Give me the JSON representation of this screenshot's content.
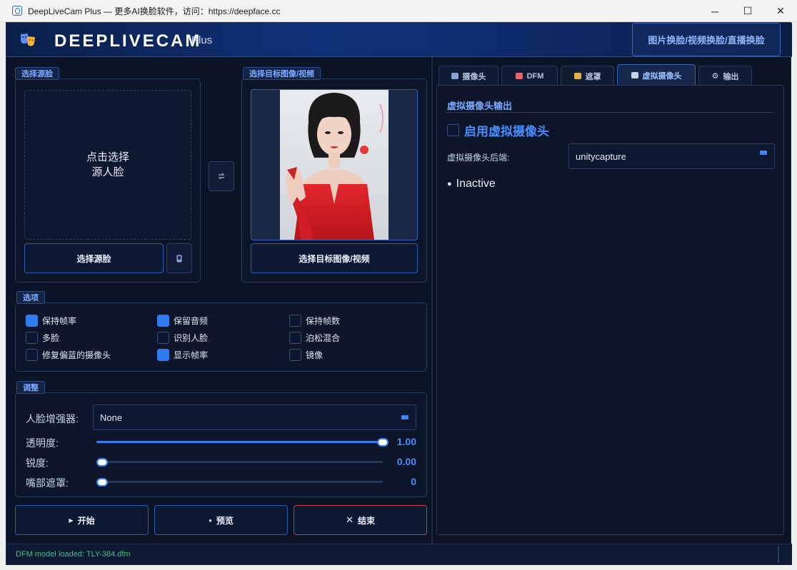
{
  "window": {
    "title": "DeepLiveCam Plus — 更多AI换脸软件，访问：https://deepface.cc",
    "minimize_glyph": "─",
    "maximize_glyph": "☐",
    "close_glyph": "✕"
  },
  "header": {
    "brand": "DEEPLIVECAM",
    "brand_suffix": "Plus",
    "mode_button": "图片换脸/视频换脸/直播换脸"
  },
  "source": {
    "group_label": "选择源脸",
    "drop_line1": "点击选择",
    "drop_line2": "源人脸",
    "select_button": "选择源脸",
    "small_icon": "camera-icon"
  },
  "swap_button_icon": "swap-icon",
  "target": {
    "group_label": "选择目标图像/视频",
    "select_button": "选择目标图像/视频"
  },
  "options": {
    "group_label": "选项",
    "items": [
      {
        "label": "保持帧率",
        "checked": true
      },
      {
        "label": "保留音频",
        "checked": true
      },
      {
        "label": "保持帧数",
        "checked": false
      },
      {
        "label": "多脸",
        "checked": false
      },
      {
        "label": "识别人脸",
        "checked": false
      },
      {
        "label": "泊松混合",
        "checked": false
      },
      {
        "label": "修复偏蓝的摄像头",
        "checked": false
      },
      {
        "label": "显示帧率",
        "checked": true
      },
      {
        "label": "镜像",
        "checked": false
      }
    ]
  },
  "adjust": {
    "group_label": "调整",
    "enhancer_label": "人脸增强器:",
    "enhancer_value": "None",
    "opacity_label": "透明度:",
    "opacity_value": "1.00",
    "opacity_fraction": 1.0,
    "sharpness_label": "锐度:",
    "sharpness_value": "0.00",
    "sharpness_fraction": 0.0,
    "mouth_mask_label": "嘴部遮罩:",
    "mouth_mask_value": "0",
    "mouth_mask_fraction": 0.0
  },
  "actions": {
    "start": "开始",
    "preview": "预览",
    "stop": "结束",
    "start_icon": "play-icon",
    "preview_icon": "eye-icon",
    "stop_icon": "close-icon"
  },
  "tabs": [
    {
      "label": "摄像头",
      "icon": "camera-icon"
    },
    {
      "label": "DFM",
      "icon": "dfm-icon"
    },
    {
      "label": "遮罩",
      "icon": "mask-icon"
    },
    {
      "label": "虚拟摄像头",
      "icon": "virtual-camera-icon",
      "active": true
    },
    {
      "label": "输出",
      "icon": "gear-icon"
    }
  ],
  "virtual_cam": {
    "section_title": "虚拟摄像头输出",
    "enable_label": "启用虚拟摄像头",
    "enable_checked": false,
    "backend_label": "虚拟摄像头后端:",
    "backend_value": "unitycapture",
    "status_dot": "●",
    "status_text": "Inactive"
  },
  "status_bar": {
    "message": "DFM model loaded: TLY-384.dfm"
  },
  "colors": {
    "accent": "#3a7ff0",
    "background": "#0b1326",
    "status_green": "#3ec27f",
    "danger": "#c43b4a"
  }
}
